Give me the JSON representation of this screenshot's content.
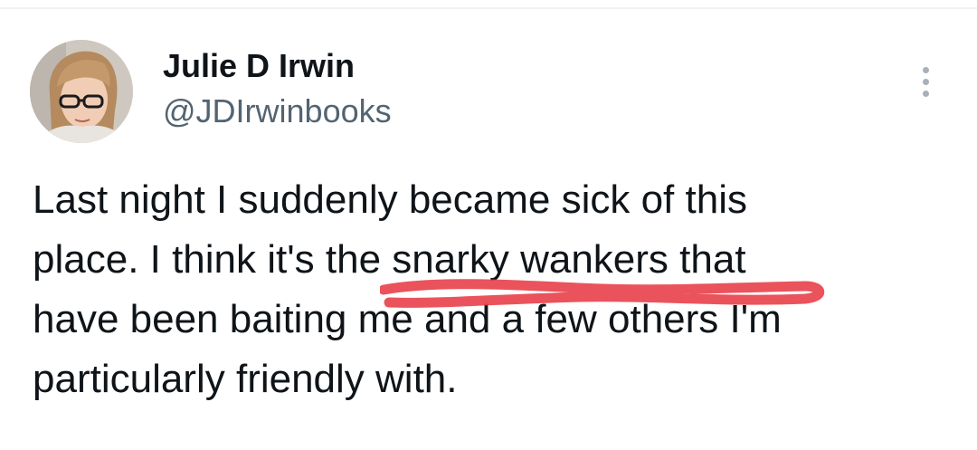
{
  "tweet": {
    "author": {
      "display_name": "Julie D Irwin",
      "handle": "@JDIrwinbooks",
      "avatar_icon": "profile-photo-woman-with-glasses"
    },
    "text_lines": [
      "Last night I suddenly became sick of this",
      "place. I think it's the snarky wankers that",
      "have been baiting me and a few others I'm",
      "particularly friendly with."
    ],
    "more_icon": "more-vertical-icon",
    "annotation_color": "#e8404a"
  }
}
